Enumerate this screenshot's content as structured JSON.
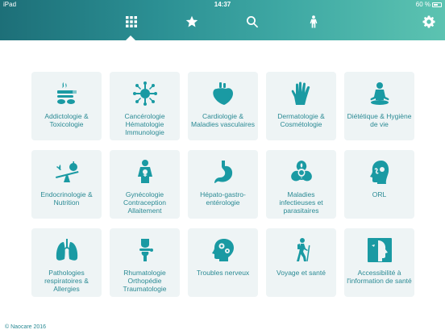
{
  "status": {
    "device": "iPad",
    "time": "14:37",
    "battery": "60 %"
  },
  "colors": {
    "accent": "#1a9aa3",
    "tile_bg": "#eef4f5",
    "header_start": "#1d6f78",
    "header_end": "#5cc3b1"
  },
  "nav": {
    "items": [
      {
        "icon": "grid-icon",
        "active": true
      },
      {
        "icon": "star-icon",
        "active": false
      },
      {
        "icon": "search-icon",
        "active": false
      },
      {
        "icon": "body-icon",
        "active": false
      }
    ],
    "settings_icon": "gear-icon"
  },
  "tiles": [
    {
      "label": "Addictologie & Toxicologie",
      "icon": "addiction-icon"
    },
    {
      "label": "Cancérologie Hématologie Immunologie",
      "icon": "virus-cell-icon"
    },
    {
      "label": "Cardiologie & Maladies vasculaires",
      "icon": "heart-icon"
    },
    {
      "label": "Dermatologie & Cosmétologie",
      "icon": "hand-skin-icon"
    },
    {
      "label": "Diététique & Hygiène de vie",
      "icon": "meditation-icon"
    },
    {
      "label": "Endocrinologie & Nutrition",
      "icon": "scale-apple-icon"
    },
    {
      "label": "Gynécologie Contraception Allaitement",
      "icon": "woman-icon"
    },
    {
      "label": "Hépato-gastro-entérologie",
      "icon": "stomach-icon"
    },
    {
      "label": "Maladies infectieuses et parasitaires",
      "icon": "biohazard-icon"
    },
    {
      "label": "ORL",
      "icon": "head-ent-icon"
    },
    {
      "label": "Pathologies respiratoires & Allergies",
      "icon": "lungs-icon"
    },
    {
      "label": "Rhumatologie Orthopédie Traumatologie",
      "icon": "bone-joint-icon"
    },
    {
      "label": "Troubles nerveux",
      "icon": "brain-gears-icon"
    },
    {
      "label": "Voyage et santé",
      "icon": "hiker-icon"
    },
    {
      "label": "Accessibilité à l'information de santé",
      "icon": "face-profile-icon"
    }
  ],
  "footer": {
    "copyright": "© Naocare 2016"
  }
}
